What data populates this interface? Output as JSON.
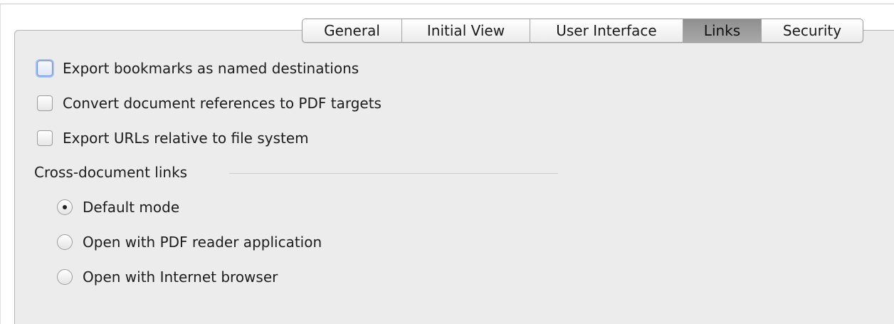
{
  "tabs": [
    {
      "label": "General"
    },
    {
      "label": "Initial View"
    },
    {
      "label": "User Interface"
    },
    {
      "label": "Links",
      "active": true
    },
    {
      "label": "Security"
    }
  ],
  "options": {
    "export_bookmarks": {
      "label": "Export bookmarks as named destinations",
      "checked": false,
      "focused": true
    },
    "convert_references": {
      "label": "Convert document references to PDF targets",
      "checked": false
    },
    "export_urls_relative": {
      "label": "Export URLs relative to file system",
      "checked": false
    }
  },
  "cross_document_links": {
    "title": "Cross-document links",
    "options": [
      {
        "label": "Default mode",
        "selected": true
      },
      {
        "label": "Open with PDF reader application",
        "selected": false
      },
      {
        "label": "Open with Internet browser",
        "selected": false
      }
    ]
  }
}
